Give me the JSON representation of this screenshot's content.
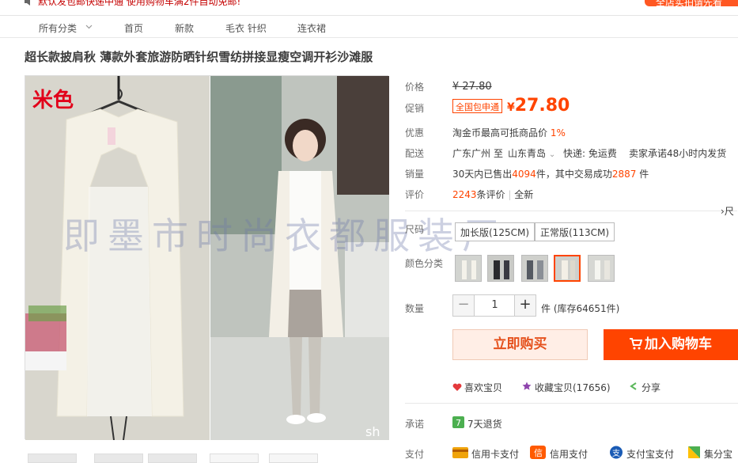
{
  "topbar": {
    "message": "默认发包邮快递中通 使用购物车满2件自动免邮!",
    "banner": "全店实拍请先看"
  },
  "nav": {
    "items": [
      "所有分类",
      "首页",
      "新款",
      "毛衣 针织",
      "连衣裙"
    ]
  },
  "product": {
    "title": "超长款披肩秋 薄款外套旅游防晒针织雪纺拼接显瘦空调开衫沙滩服",
    "color_tag": "米色",
    "watermark": "即墨市时尚衣都服装厂",
    "gallery_caption": "sh"
  },
  "details": {
    "price_label": "价格",
    "old_price": "¥ 27.80",
    "promo_label": "促销",
    "promo_tag": "全国包申通",
    "currency": "¥",
    "price": "27.80",
    "discount_label": "优惠",
    "discount_text": "淘金币最高可抵商品价",
    "discount_pct": "1%",
    "ship_label": "配送",
    "ship_from": "广东广州",
    "ship_to_word": "至",
    "ship_to": "山东青岛",
    "ship_fee": "快递: 免运费",
    "ship_promise": "卖家承诺48小时内发货",
    "sales_label": "销量",
    "sales_prefix": "30天内已售出",
    "sales_count": "4094",
    "sales_mid": "件，其中交易成功",
    "sales_success": "2887",
    "sales_suffix": "件",
    "review_label": "评价",
    "review_count": "2243",
    "review_word": "条评价",
    "review_new": "全新",
    "size_label": "尺码",
    "size_side": "尺",
    "sizes": [
      "加长版(125CM)",
      "正常版(113CM)"
    ],
    "color_label": "颜色分类",
    "qty_label": "数量",
    "qty_value": "1",
    "qty_minus": "−",
    "qty_plus": "+",
    "stock_text": "件 (库存64651件)",
    "buy_now": "立即购买",
    "add_cart": "加入购物车",
    "like": "喜欢宝贝",
    "favorite": "收藏宝贝(17656)",
    "share": "分享",
    "promise_label": "承诺",
    "promise_text": "7天退货",
    "pay_label": "支付",
    "pay_methods": [
      "信用卡支付",
      "信用支付",
      "支付宝支付",
      "集分宝"
    ]
  },
  "colors": {
    "accent": "#ff4400",
    "price": "#ff4400",
    "heart": "#e4393c",
    "star": "#8e44ad",
    "share": "#5cb85c"
  }
}
